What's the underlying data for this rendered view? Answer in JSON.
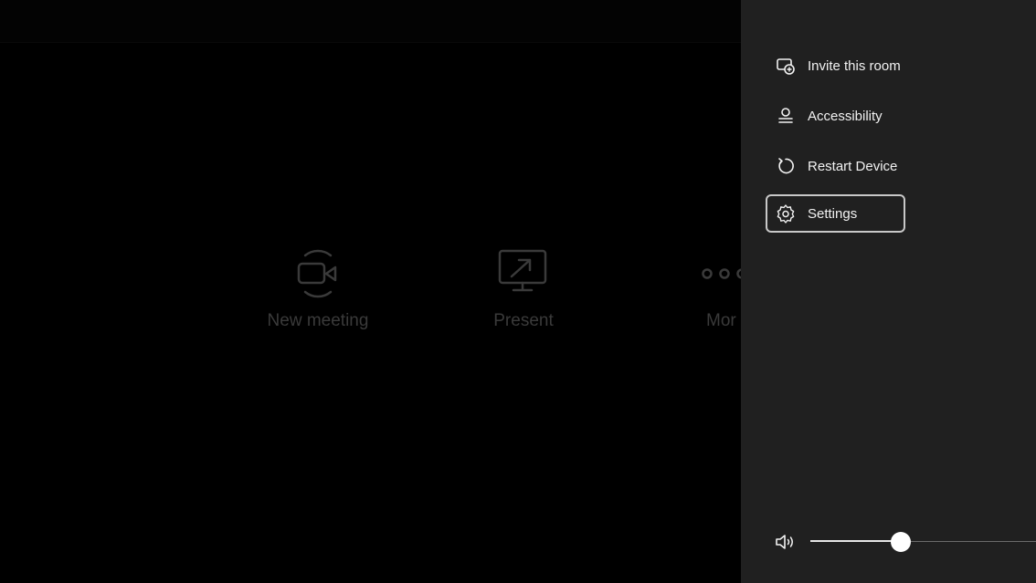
{
  "main": {
    "actions": [
      {
        "label": "New meeting",
        "icon": "video-camera-icon"
      },
      {
        "label": "Present",
        "icon": "present-screen-icon"
      },
      {
        "label": "Mor",
        "icon": "more-dots-icon"
      }
    ]
  },
  "panel": {
    "items": [
      {
        "label": "Invite this room",
        "icon": "invite-room-icon"
      },
      {
        "label": "Accessibility",
        "icon": "accessibility-icon"
      },
      {
        "label": "Restart Device",
        "icon": "restart-icon"
      },
      {
        "label": "Settings",
        "icon": "gear-icon",
        "focused": true
      }
    ],
    "volume": {
      "icon": "speaker-icon",
      "level_percent": 40
    }
  },
  "colors": {
    "panel_bg": "#202020",
    "main_bg": "#000000",
    "dim_text": "#3a3a3a"
  }
}
